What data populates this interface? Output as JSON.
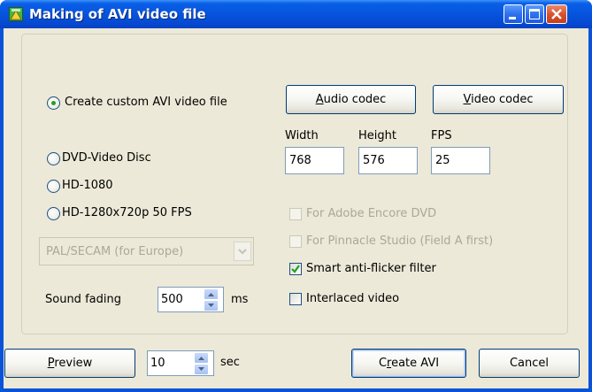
{
  "window": {
    "title": "Making of AVI video file"
  },
  "mode": {
    "custom_avi": "Create custom AVI video file",
    "dvd": "DVD-Video Disc",
    "hd1080": "HD-1080",
    "hd720": "HD-1280x720p 50 FPS",
    "selected": "custom_avi"
  },
  "codecs": {
    "audio_pre": "",
    "audio_key": "A",
    "audio_rest": "udio codec",
    "video_pre": "",
    "video_key": "V",
    "video_rest": "ideo codec"
  },
  "dims": {
    "width_label": "Width",
    "height_label": "Height",
    "fps_label": "FPS",
    "width": "768",
    "height": "576",
    "fps": "25"
  },
  "tv_standard": {
    "selected": "PAL/SECAM (for Europe)"
  },
  "sound": {
    "label": "Sound fading",
    "value": "500",
    "unit": "ms"
  },
  "options": {
    "adobe": {
      "label": "For Adobe Encore DVD",
      "checked": false,
      "enabled": false
    },
    "pinnacle": {
      "label": "For Pinnacle Studio (Field A first)",
      "checked": false,
      "enabled": false
    },
    "antiflicker": {
      "label": "Smart anti-flicker filter",
      "checked": true,
      "enabled": true
    },
    "interlaced": {
      "label": "Interlaced video",
      "checked": false,
      "enabled": true
    }
  },
  "footer": {
    "preview_key": "P",
    "preview_rest": "review",
    "preview_seconds": "10",
    "seconds_unit": "sec",
    "create_pre": "C",
    "create_key": "r",
    "create_rest": "eate AVI",
    "cancel": "Cancel"
  },
  "colors": {
    "titlebar": "#0755de",
    "dialog_bg": "#ece9d8",
    "button_border": "#003c74",
    "check_green": "#21a121"
  }
}
